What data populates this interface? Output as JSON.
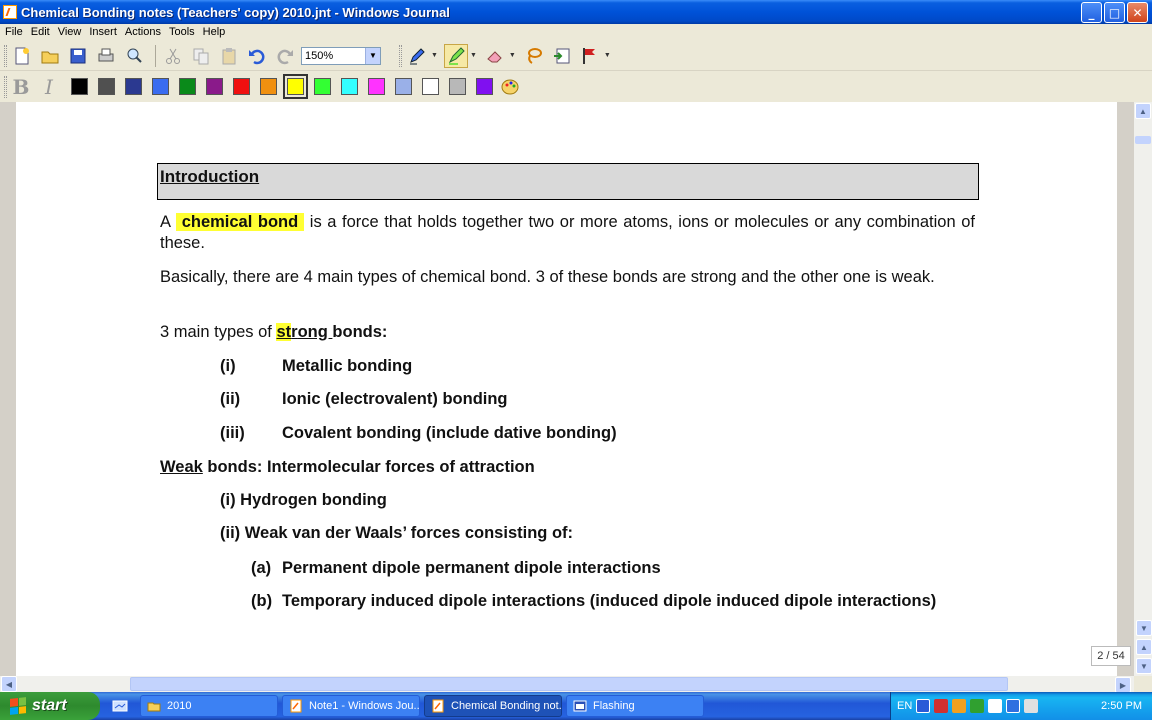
{
  "window": {
    "title": "Chemical Bonding notes (Teachers' copy) 2010.jnt - Windows Journal",
    "buttons": {
      "minimize": "_",
      "maximize": "□",
      "close": "✕"
    }
  },
  "menu": {
    "items": [
      "File",
      "Edit",
      "View",
      "Insert",
      "Actions",
      "Tools",
      "Help"
    ]
  },
  "toolbar": {
    "zoom_value": "150%",
    "format": {
      "bold": "B",
      "italic": "I"
    },
    "colors": [
      "#000000",
      "#505050",
      "#2b3990",
      "#3a6cf0",
      "#0a8a1a",
      "#8a1a8a",
      "#f01010",
      "#f09010",
      "#ffff00",
      "#33ff33",
      "#33ffff",
      "#ff33ff",
      "#9ab0e8",
      "#ffffff",
      "#b8b8b8",
      "#8010f0"
    ],
    "selected_color": "#ffff00"
  },
  "document": {
    "intro_title": "Introduction",
    "p1": {
      "prefix": "A",
      "highlight": "chemical bond",
      "rest": "is a force that holds together two or more atoms, ions or molecules or any combination of these."
    },
    "p2": "Basically, there are 4 main types of chemical bond. 3 of these bonds are strong and the other one is weak.",
    "p3": {
      "prefix": "3 main types of ",
      "hl_part": "st",
      "mid": "r",
      "u_part": "ong ",
      "suffix": "bonds:"
    },
    "strong_list": [
      {
        "num": "(i)",
        "text": "Metallic bonding"
      },
      {
        "num": "(ii)",
        "text": "Ionic (electrovalent) bonding"
      },
      {
        "num": "(iii)",
        "text": "Covalent bonding (include dative bonding)"
      }
    ],
    "weak_heading": {
      "underlined": "Weak",
      "rest": " bonds: Intermolecular forces of attraction"
    },
    "weak_list": [
      "(i) Hydrogen bonding",
      "(ii) Weak van der Waals’ forces consisting of:"
    ],
    "sub_list": [
      {
        "num": "(a)",
        "text": "Permanent dipole permanent dipole interactions"
      },
      {
        "num": "(b)",
        "text": "Temporary induced dipole interactions (induced dipole induced dipole interactions)"
      }
    ]
  },
  "status": {
    "page_indicator": "2 / 54"
  },
  "taskbar": {
    "start_label": "start",
    "tasks": [
      {
        "label": "2010",
        "active": false
      },
      {
        "label": "Note1 - Windows Jou...",
        "active": false
      },
      {
        "label": "Chemical Bonding not...",
        "active": true
      },
      {
        "label": "Flashing",
        "active": false
      }
    ],
    "language": "EN",
    "clock": "2:50 PM"
  }
}
